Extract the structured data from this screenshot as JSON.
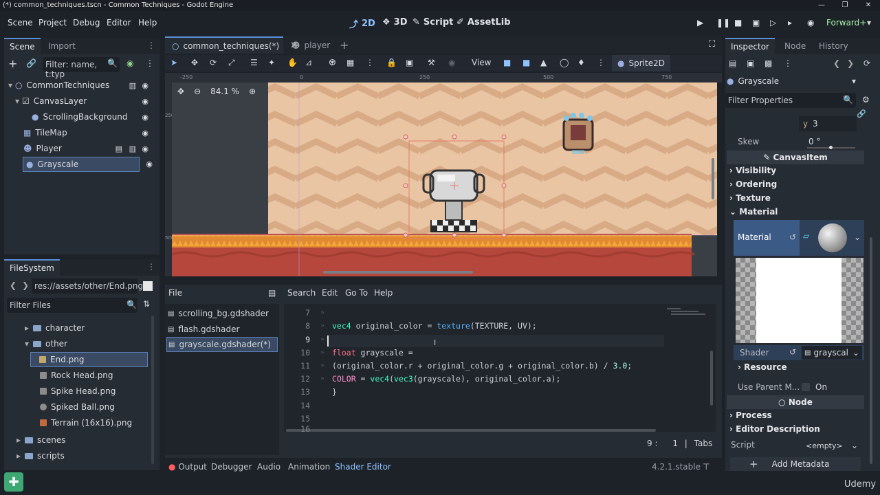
{
  "window": {
    "title": "(*) common_techniques.tscn - Common Techniques - Godot Engine"
  },
  "menu": [
    "Scene",
    "Project",
    "Debug",
    "Editor",
    "Help"
  ],
  "workspaces": {
    "twod": "2D",
    "threed": "3D",
    "script": "Script",
    "assetlib": "AssetLib"
  },
  "renderer": "Forward+",
  "scene_dock": {
    "tabs": [
      "Scene",
      "Import"
    ],
    "filter_placeholder": "Filter: name, t:typ",
    "nodes": [
      {
        "label": "CommonTechniques"
      },
      {
        "label": "CanvasLayer"
      },
      {
        "label": "ScrollingBackground"
      },
      {
        "label": "TileMap"
      },
      {
        "label": "Player"
      },
      {
        "label": "Grayscale"
      }
    ]
  },
  "filesystem": {
    "tab": "FileSystem",
    "path": "res://assets/other/End.png",
    "filter_placeholder": "Filter Files",
    "items": [
      {
        "label": "character"
      },
      {
        "label": "other"
      },
      {
        "label": "End.png"
      },
      {
        "label": "Rock Head.png"
      },
      {
        "label": "Spike Head.png"
      },
      {
        "label": "Spiked Ball.png"
      },
      {
        "label": "Terrain (16x16).png"
      },
      {
        "label": "scenes"
      },
      {
        "label": "scripts"
      }
    ]
  },
  "editor_tabs": {
    "active": "common_techniques(*)",
    "other": "player"
  },
  "toolbar": {
    "view": "View",
    "node_type": "Sprite2D"
  },
  "viewport": {
    "zoom": "84.1 %",
    "ruler": [
      "-250",
      "0",
      "250",
      "500",
      "750"
    ],
    "ruler_left": [
      "250",
      "500"
    ]
  },
  "shader_editor": {
    "file_menu": "File",
    "menus": [
      "Search",
      "Edit",
      "Go To",
      "Help"
    ],
    "files": [
      "scrolling_bg.gdshader",
      "flash.gdshader",
      "grayscale.gdshader(*)"
    ],
    "line_numbers": [
      "7",
      "8",
      "9",
      "10",
      "11",
      "12",
      "13",
      "14",
      "15",
      "16"
    ],
    "cursor": "9 :",
    "col": "1",
    "indent": "Tabs"
  },
  "code": {
    "l8": {
      "t1": "vec4",
      "t2": " original_color = ",
      "t3": "texture",
      "t4": "(TEXTURE, UV);"
    },
    "l10": {
      "t1": "float",
      "t2": " grayscale ="
    },
    "l11": {
      "t1": "(original_color.r + original_color.g + original_color.b) / ",
      "t2": "3.0",
      "t3": ";"
    },
    "l12": {
      "t1": "COLOR",
      "t2": " = ",
      "t3": "vec4",
      "t4": "(",
      "t5": "vec3",
      "t6": "(grayscale), original_color.a);"
    },
    "l13": "}"
  },
  "bottom_panel": {
    "tabs": [
      "Output",
      "Debugger",
      "Audio",
      "Animation",
      "Shader Editor"
    ],
    "version": "4.2.1.stable"
  },
  "inspector": {
    "tabs": [
      "Inspector",
      "Node",
      "History"
    ],
    "object": "Grayscale",
    "filter_placeholder": "Filter Properties",
    "y_label": "y",
    "y_value": "3",
    "skew_label": "Skew",
    "skew_value": "0 °",
    "canvasitem": "CanvasItem",
    "sections": [
      "Visibility",
      "Ordering",
      "Texture",
      "Material"
    ],
    "material_label": "Material",
    "shader_label": "Shader",
    "shader_value": "grayscal",
    "resource": "Resource",
    "use_parent_label": "Use Parent M...",
    "use_parent_value": "On",
    "node_header": "Node",
    "node_sections": [
      "Process",
      "Editor Description"
    ],
    "script_label": "Script",
    "script_value": "<empty>",
    "add_metadata": "Add Metadata"
  },
  "watermark": "Udemy"
}
